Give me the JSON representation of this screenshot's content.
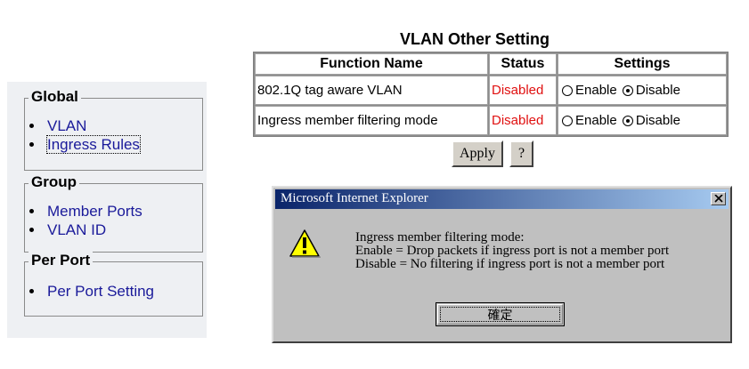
{
  "nav": {
    "groups": [
      {
        "title": "Global",
        "items": [
          "VLAN",
          "Ingress Rules"
        ]
      },
      {
        "title": "Group",
        "items": [
          "Member Ports",
          "VLAN ID"
        ]
      },
      {
        "title": "Per Port",
        "items": [
          "Per Port Setting"
        ]
      }
    ],
    "selected_item": "Ingress Rules"
  },
  "table": {
    "title": "VLAN Other Setting",
    "headers": [
      "Function Name",
      "Status",
      "Settings"
    ],
    "rows": [
      {
        "function": "802.1Q tag aware VLAN",
        "status": "Disabled",
        "enable_label": "Enable",
        "disable_label": "Disable",
        "selected": "Disable"
      },
      {
        "function": "Ingress member filtering mode",
        "status": "Disabled",
        "enable_label": "Enable",
        "disable_label": "Disable",
        "selected": "Disable"
      }
    ]
  },
  "buttons": {
    "apply": "Apply",
    "help": "?"
  },
  "dialog": {
    "title": "Microsoft Internet Explorer",
    "lines": [
      "Ingress member filtering mode:",
      "Enable = Drop packets if ingress port is not a member port",
      "Disable = No filtering if ingress port is not a member port"
    ],
    "ok": "確定"
  },
  "colors": {
    "status": "#e01010",
    "link": "#1a1a9a",
    "titlebar_start": "#0a246a",
    "titlebar_end": "#a6caf0",
    "nav_bg": "#eef0f3"
  },
  "icons": {
    "dialog": "warning-icon",
    "close": "close-icon"
  }
}
